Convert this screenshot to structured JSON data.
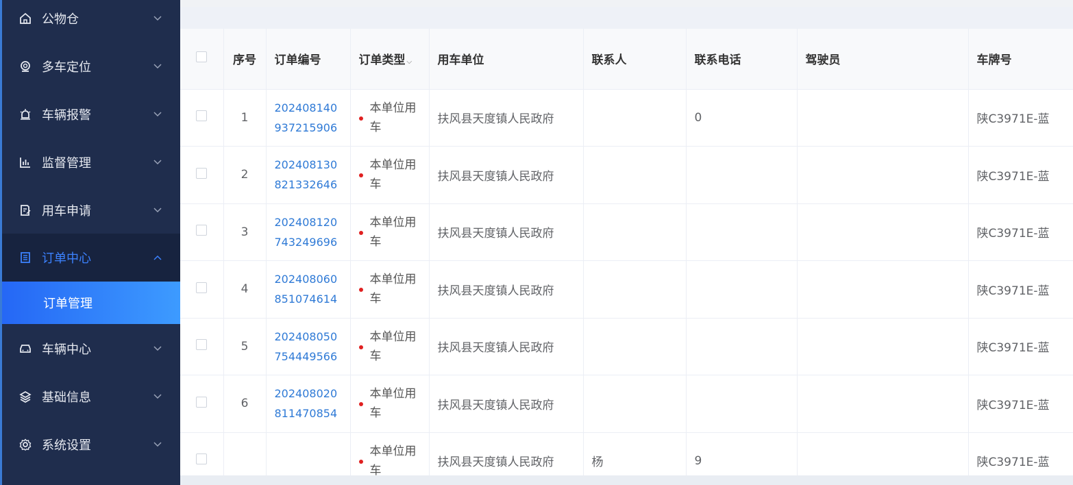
{
  "sidebar": {
    "items": [
      {
        "label": "公物仓",
        "icon": "home-icon"
      },
      {
        "label": "多车定位",
        "icon": "location-icon"
      },
      {
        "label": "车辆报警",
        "icon": "alarm-icon"
      },
      {
        "label": "监督管理",
        "icon": "chart-icon"
      },
      {
        "label": "用车申请",
        "icon": "edit-doc-icon"
      },
      {
        "label": "订单中心",
        "icon": "list-icon"
      },
      {
        "label": "车辆中心",
        "icon": "car-icon"
      },
      {
        "label": "基础信息",
        "icon": "layers-icon"
      },
      {
        "label": "系统设置",
        "icon": "gear-icon"
      }
    ],
    "submenu": {
      "label": "订单管理"
    },
    "colors": {
      "bg": "#1f2d4d",
      "active": "#3c82ff"
    }
  },
  "table": {
    "headers": {
      "index": "序号",
      "order_no": "订单编号",
      "order_type": "订单类型",
      "unit": "用车单位",
      "contact": "联系人",
      "phone": "联系电话",
      "driver": "驾驶员",
      "plate": "车牌号"
    },
    "rows": [
      {
        "index": "1",
        "order_no": "202408140937215906",
        "order_type": "本单位用车",
        "unit": "扶风县天度镇人民政府",
        "contact": "",
        "phone": "0",
        "driver": "",
        "plate": "陕C3971E-蓝"
      },
      {
        "index": "2",
        "order_no": "202408130821332646",
        "order_type": "本单位用车",
        "unit": "扶风县天度镇人民政府",
        "contact": "",
        "phone": "",
        "driver": "",
        "plate": "陕C3971E-蓝"
      },
      {
        "index": "3",
        "order_no": "202408120743249696",
        "order_type": "本单位用车",
        "unit": "扶风县天度镇人民政府",
        "contact": "",
        "phone": "",
        "driver": "",
        "plate": "陕C3971E-蓝"
      },
      {
        "index": "4",
        "order_no": "202408060851074614",
        "order_type": "本单位用车",
        "unit": "扶风县天度镇人民政府",
        "contact": "",
        "phone": "",
        "driver": "",
        "plate": "陕C3971E-蓝"
      },
      {
        "index": "5",
        "order_no": "202408050754449566",
        "order_type": "本单位用车",
        "unit": "扶风县天度镇人民政府",
        "contact": "",
        "phone": "",
        "driver": "",
        "plate": "陕C3971E-蓝"
      },
      {
        "index": "6",
        "order_no": "202408020811470854",
        "order_type": "本单位用车",
        "unit": "扶风县天度镇人民政府",
        "contact": "",
        "phone": "",
        "driver": "",
        "plate": "陕C3971E-蓝"
      },
      {
        "index": "",
        "order_no": "",
        "order_type": "本单位用车",
        "unit": "扶风县天度镇人民政府",
        "contact": "杨",
        "phone": "9",
        "driver": "",
        "plate": "陕C3971E-蓝"
      }
    ]
  }
}
